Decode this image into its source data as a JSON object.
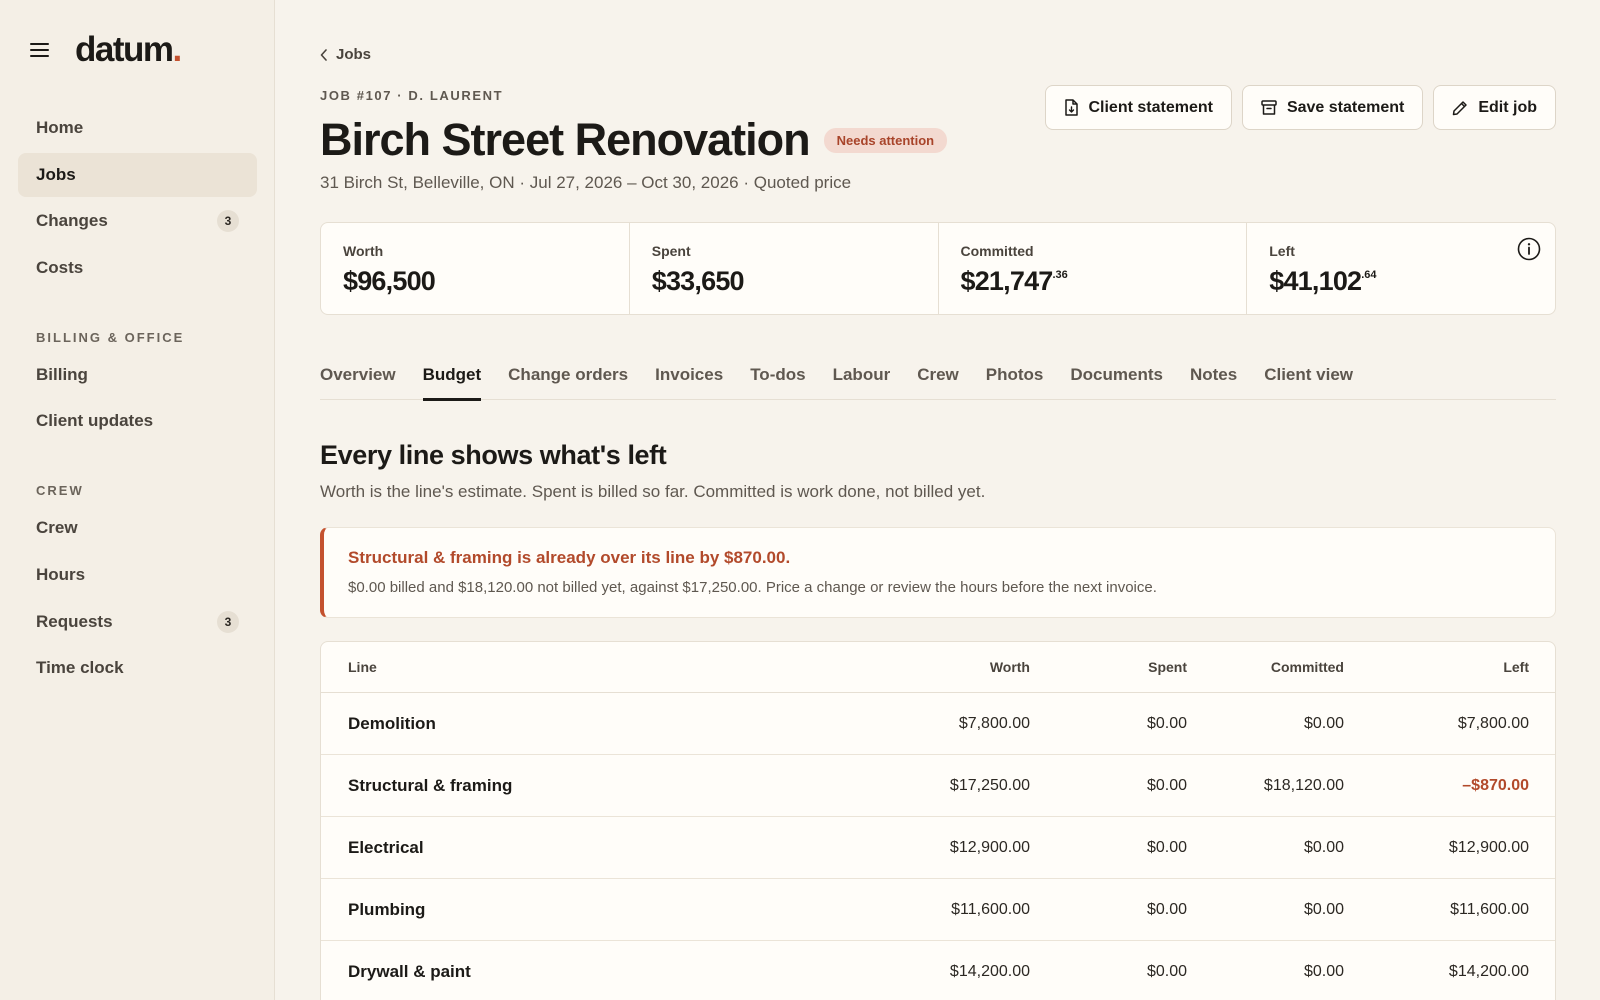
{
  "brand": {
    "name": "datum",
    "dot": "."
  },
  "sidebar": {
    "primary": [
      {
        "label": "Home",
        "badge": ""
      },
      {
        "label": "Jobs",
        "badge": ""
      },
      {
        "label": "Changes",
        "badge": "3"
      },
      {
        "label": "Costs",
        "badge": ""
      }
    ],
    "billing_heading": "BILLING & OFFICE",
    "billing": [
      {
        "label": "Billing"
      },
      {
        "label": "Client updates"
      }
    ],
    "crew_heading": "CREW",
    "crew": [
      {
        "label": "Crew",
        "badge": ""
      },
      {
        "label": "Hours",
        "badge": ""
      },
      {
        "label": "Requests",
        "badge": "3"
      },
      {
        "label": "Time clock",
        "badge": ""
      }
    ]
  },
  "job": {
    "breadcrumb": "Jobs",
    "eyebrow": "JOB #107 · D. LAURENT",
    "title": "Birch Street Renovation",
    "status": "Needs attention",
    "subline": "31 Birch St, Belleville, ON · Jul 27, 2026 – Oct 30, 2026 · Quoted price"
  },
  "actions": {
    "client_statement": "Client statement",
    "save_statement": "Save statement",
    "edit_job": "Edit job"
  },
  "stats": {
    "worth": {
      "label": "Worth",
      "value": "$96,500",
      "cents": ""
    },
    "spent": {
      "label": "Spent",
      "value": "$33,650",
      "cents": ""
    },
    "committed": {
      "label": "Committed",
      "value": "$21,747",
      "cents": ".36"
    },
    "left": {
      "label": "Left",
      "value": "$41,102",
      "cents": ".64"
    }
  },
  "tabs": [
    "Overview",
    "Budget",
    "Change orders",
    "Invoices",
    "To-dos",
    "Labour",
    "Crew",
    "Photos",
    "Documents",
    "Notes",
    "Client view"
  ],
  "active_tab": "Budget",
  "section": {
    "title": "Every line shows what's left",
    "subtitle": "Worth is the line's estimate. Spent is billed so far. Committed is work done, not billed yet."
  },
  "alert": {
    "title": "Structural & framing is already over its line by $870.00.",
    "body": "$0.00 billed and $18,120.00 not billed yet, against $17,250.00. Price a change or review the hours before the next invoice."
  },
  "table": {
    "headers": {
      "line": "Line",
      "worth": "Worth",
      "spent": "Spent",
      "committed": "Committed",
      "left": "Left"
    },
    "rows": [
      {
        "line": "Demolition",
        "worth": "$7,800.00",
        "spent": "$0.00",
        "committed": "$0.00",
        "left": "$7,800.00"
      },
      {
        "line": "Structural & framing",
        "worth": "$17,250.00",
        "spent": "$0.00",
        "committed": "$18,120.00",
        "left": "–$870.00"
      },
      {
        "line": "Electrical",
        "worth": "$12,900.00",
        "spent": "$0.00",
        "committed": "$0.00",
        "left": "$12,900.00"
      },
      {
        "line": "Plumbing",
        "worth": "$11,600.00",
        "spent": "$0.00",
        "committed": "$0.00",
        "left": "$11,600.00"
      },
      {
        "line": "Drywall & paint",
        "worth": "$14,200.00",
        "spent": "$0.00",
        "committed": "$0.00",
        "left": "$14,200.00"
      }
    ]
  },
  "colors": {
    "accent": "#c4522f",
    "background": "#f7f3ec",
    "sidebar": "#f4efe6",
    "card": "#fffdf9",
    "badge_bg": "#f3d9d0",
    "negative": "#b24a2b"
  }
}
